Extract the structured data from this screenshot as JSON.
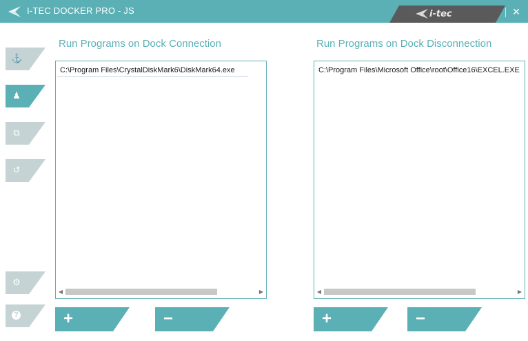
{
  "window": {
    "title": "I-TEC DOCKER PRO - JS",
    "brand": "i-tec",
    "close_symbol": "✕"
  },
  "colors": {
    "accent": "#5bb0b6",
    "sidebar_inactive": "#c5d3d4",
    "brand_tab": "#5a5a5a"
  },
  "sidebar": {
    "items": [
      {
        "name": "anchor-icon",
        "symbol": "⚓",
        "active": false
      },
      {
        "name": "user-icon",
        "symbol": "♟",
        "active": true
      },
      {
        "name": "network-icon",
        "symbol": "⧉",
        "active": false
      },
      {
        "name": "history-icon",
        "symbol": "↺",
        "active": false
      },
      {
        "name": "gear-icon",
        "symbol": "⚙",
        "active": false
      },
      {
        "name": "help-icon",
        "symbol": "?",
        "active": false
      }
    ]
  },
  "connect_panel": {
    "title": "Run Programs on Dock Connection",
    "items": [
      "C:\\Program Files\\CrystalDiskMark6\\DiskMark64.exe"
    ],
    "add_symbol": "+",
    "remove_symbol": "−"
  },
  "disconnect_panel": {
    "title": "Run Programs on Dock Disconnection",
    "items": [
      "C:\\Program Files\\Microsoft Office\\root\\Office16\\EXCEL.EXE"
    ],
    "add_symbol": "+",
    "remove_symbol": "−"
  }
}
